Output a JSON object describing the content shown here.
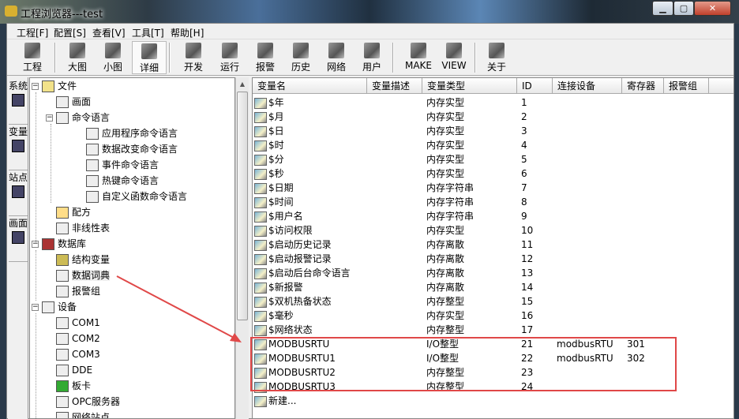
{
  "window": {
    "title": "工程浏览器---test",
    "controls": [
      "minimize",
      "maximize",
      "close"
    ]
  },
  "menu": [
    "工程[F]",
    "配置[S]",
    "查看[V]",
    "工具[T]",
    "帮助[H]"
  ],
  "toolbar": [
    {
      "label": "工程",
      "icon": "project-icon"
    },
    {
      "label": "大图",
      "icon": "large-icons-icon"
    },
    {
      "label": "小图",
      "icon": "small-icons-icon"
    },
    {
      "label": "详细",
      "icon": "details-icon",
      "pressed": true
    },
    {
      "label": "开发",
      "icon": "develop-icon"
    },
    {
      "label": "运行",
      "icon": "run-icon"
    },
    {
      "label": "报警",
      "icon": "alarm-icon"
    },
    {
      "label": "历史",
      "icon": "history-icon"
    },
    {
      "label": "网络",
      "icon": "network-icon"
    },
    {
      "label": "用户",
      "icon": "user-icon"
    },
    {
      "label": "MAKE",
      "icon": "make-icon"
    },
    {
      "label": "VIEW",
      "icon": "view-icon"
    },
    {
      "label": "关于",
      "icon": "about-icon"
    }
  ],
  "side_tabs": [
    "系统",
    "变量",
    "站点",
    "画面"
  ],
  "tree": [
    {
      "label": "文件",
      "level": 0,
      "expanded": true
    },
    {
      "label": "画面",
      "level": 1
    },
    {
      "label": "命令语言",
      "level": 1,
      "expanded": true
    },
    {
      "label": "应用程序命令语言",
      "level": 2
    },
    {
      "label": "数据改变命令语言",
      "level": 2
    },
    {
      "label": "事件命令语言",
      "level": 2
    },
    {
      "label": "热键命令语言",
      "level": 2
    },
    {
      "label": "自定义函数命令语言",
      "level": 2
    },
    {
      "label": "配方",
      "level": 1
    },
    {
      "label": "非线性表",
      "level": 1
    },
    {
      "label": "数据库",
      "level": 0,
      "expanded": true
    },
    {
      "label": "结构变量",
      "level": 1
    },
    {
      "label": "数据词典",
      "level": 1,
      "selected": true
    },
    {
      "label": "报警组",
      "level": 1
    },
    {
      "label": "设备",
      "level": 0,
      "expanded": true
    },
    {
      "label": "COM1",
      "level": 1
    },
    {
      "label": "COM2",
      "level": 1
    },
    {
      "label": "COM3",
      "level": 1
    },
    {
      "label": "DDE",
      "level": 1
    },
    {
      "label": "板卡",
      "level": 1
    },
    {
      "label": "OPC服务器",
      "level": 1
    },
    {
      "label": "网络站点",
      "level": 1
    }
  ],
  "columns": [
    "变量名",
    "变量描述",
    "变量类型",
    "ID",
    "连接设备",
    "寄存器",
    "报警组"
  ],
  "rows": [
    [
      "$年",
      "",
      "内存实型",
      "1",
      "",
      ""
    ],
    [
      "$月",
      "",
      "内存实型",
      "2",
      "",
      ""
    ],
    [
      "$日",
      "",
      "内存实型",
      "3",
      "",
      ""
    ],
    [
      "$时",
      "",
      "内存实型",
      "4",
      "",
      ""
    ],
    [
      "$分",
      "",
      "内存实型",
      "5",
      "",
      ""
    ],
    [
      "$秒",
      "",
      "内存实型",
      "6",
      "",
      ""
    ],
    [
      "$日期",
      "",
      "内存字符串",
      "7",
      "",
      ""
    ],
    [
      "$时间",
      "",
      "内存字符串",
      "8",
      "",
      ""
    ],
    [
      "$用户名",
      "",
      "内存字符串",
      "9",
      "",
      ""
    ],
    [
      "$访问权限",
      "",
      "内存实型",
      "10",
      "",
      ""
    ],
    [
      "$启动历史记录",
      "",
      "内存离散",
      "11",
      "",
      ""
    ],
    [
      "$启动报警记录",
      "",
      "内存离散",
      "12",
      "",
      ""
    ],
    [
      "$启动后台命令语言",
      "",
      "内存离散",
      "13",
      "",
      ""
    ],
    [
      "$新报警",
      "",
      "内存离散",
      "14",
      "",
      ""
    ],
    [
      "$双机热备状态",
      "",
      "内存整型",
      "15",
      "",
      ""
    ],
    [
      "$毫秒",
      "",
      "内存实型",
      "16",
      "",
      ""
    ],
    [
      "$网络状态",
      "",
      "内存整型",
      "17",
      "",
      ""
    ],
    [
      "MODBUSRTU",
      "",
      "I/O整型",
      "21",
      "modbusRTU",
      "301"
    ],
    [
      "MODBUSRTU1",
      "",
      "I/O整型",
      "22",
      "modbusRTU",
      "302"
    ],
    [
      "MODBUSRTU2",
      "",
      "内存整型",
      "23",
      "",
      ""
    ],
    [
      "MODBUSRTU3",
      "",
      "内存整型",
      "24",
      "",
      ""
    ],
    [
      "新建...",
      "",
      "",
      "",
      "",
      ""
    ]
  ],
  "colors": {
    "highlight": "#e04848"
  }
}
